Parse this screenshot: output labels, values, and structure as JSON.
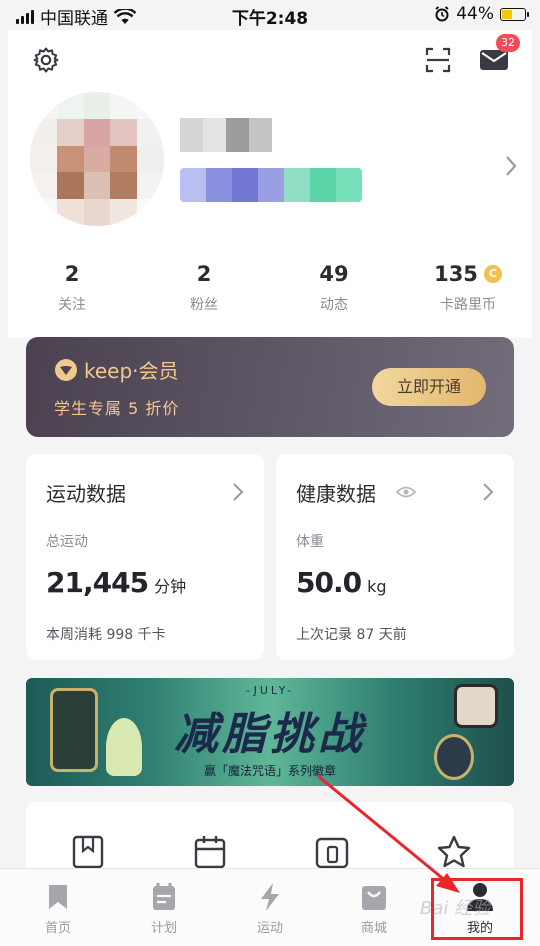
{
  "status_bar": {
    "carrier": "中国联通",
    "time": "下午2:48",
    "battery": "44%"
  },
  "header": {
    "mail_badge": "32"
  },
  "stats": [
    {
      "value": "2",
      "label": "关注"
    },
    {
      "value": "2",
      "label": "粉丝"
    },
    {
      "value": "49",
      "label": "动态"
    },
    {
      "value": "135",
      "label": "卡路里币"
    }
  ],
  "vip": {
    "logo_text": "keep·会员",
    "desc": "学生专属 5 折价",
    "button": "立即开通"
  },
  "sport_card": {
    "title": "运动数据",
    "sub": "总运动",
    "value": "21,445",
    "unit": "分钟",
    "foot": "本周消耗 998 千卡"
  },
  "health_card": {
    "title": "健康数据",
    "sub": "体重",
    "value": "50.0",
    "unit": "kg",
    "foot": "上次记录 87 天前"
  },
  "banner": {
    "top": "-JULY-",
    "title": "减脂挑战",
    "subtitle": "赢「魔法咒语」系列徽章"
  },
  "tabs": [
    {
      "label": "首页",
      "icon": "bookmark-icon"
    },
    {
      "label": "计划",
      "icon": "calendar-icon"
    },
    {
      "label": "运动",
      "icon": "lightning-icon"
    },
    {
      "label": "商城",
      "icon": "shopping-bag-icon"
    },
    {
      "label": "我的",
      "icon": "user-icon"
    }
  ],
  "watermark": "Bai 经验"
}
